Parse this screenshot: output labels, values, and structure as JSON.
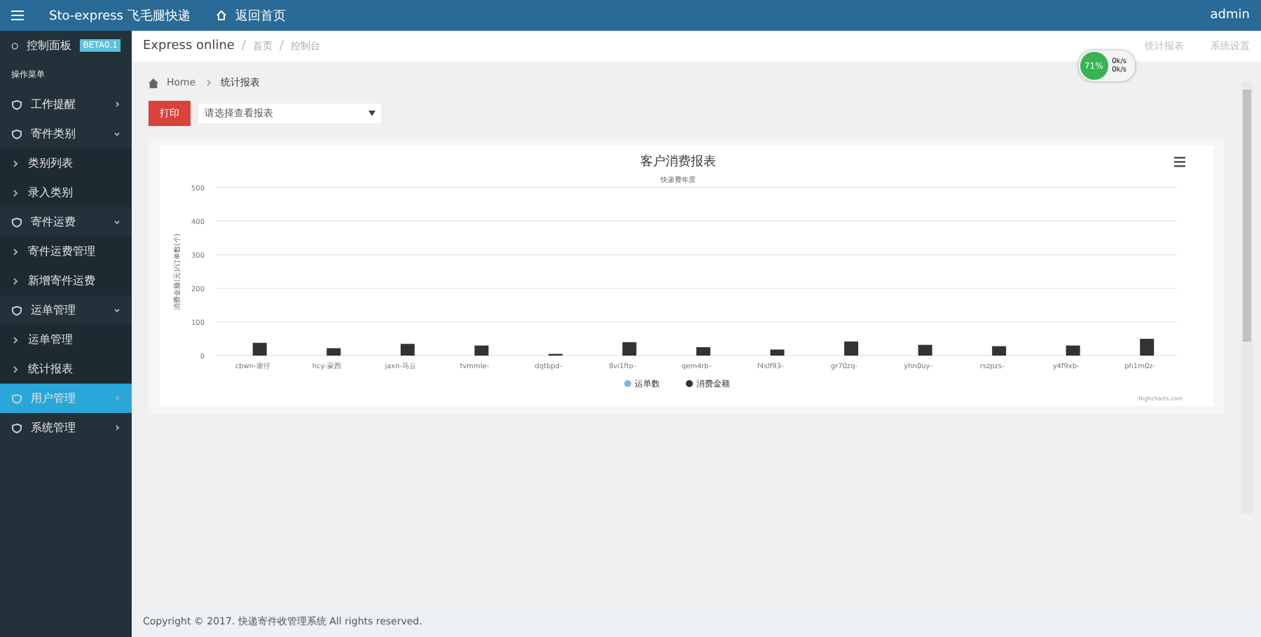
{
  "topbar": {
    "brand": "Sto-express 飞毛腿快递",
    "home_link": "返回首页",
    "user": "admin"
  },
  "sidebar": {
    "dashboard": {
      "label": "控制面板",
      "badge": "BETA0.1"
    },
    "section": "操作菜单",
    "items": [
      {
        "label": "工作提醒",
        "kind": "group",
        "expanded": false,
        "selected": false
      },
      {
        "label": "寄件类别",
        "kind": "group",
        "expanded": true,
        "selected": false
      },
      {
        "label": "类别列表",
        "kind": "sub",
        "selected": false
      },
      {
        "label": "录入类别",
        "kind": "sub",
        "selected": false
      },
      {
        "label": "寄件运费",
        "kind": "group",
        "expanded": true,
        "selected": false
      },
      {
        "label": "寄件运费管理",
        "kind": "sub",
        "selected": false
      },
      {
        "label": "新增寄件运费",
        "kind": "sub",
        "selected": false
      },
      {
        "label": "运单管理",
        "kind": "group",
        "expanded": true,
        "selected": false
      },
      {
        "label": "运单管理",
        "kind": "sub",
        "selected": false
      },
      {
        "label": "统计报表",
        "kind": "sub",
        "selected": false
      },
      {
        "label": "用户管理",
        "kind": "group",
        "expanded": false,
        "selected": true
      },
      {
        "label": "系统管理",
        "kind": "group",
        "expanded": false,
        "selected": false
      }
    ]
  },
  "header": {
    "breadcrumb": [
      "Express online",
      "首页",
      "控制台"
    ],
    "separator": "/",
    "actions": [
      "统计报表",
      "系统设置"
    ]
  },
  "speed_widget": {
    "percent": "71%",
    "up": "0k/s",
    "down": "0k/s"
  },
  "page": {
    "breadcrumb": [
      "Home",
      "统计报表"
    ],
    "print_button": "打印",
    "report_select": {
      "value": "请选择查看报表"
    }
  },
  "chart": {
    "credit": "Highcharts.com",
    "chart_data": {
      "type": "bar",
      "grid": true,
      "title": "客户消费报表",
      "subtitle": "快递费年度",
      "ylabel": "消费金额(元)/订单数(个)",
      "ylim": [
        0,
        500
      ],
      "yticks": [
        0,
        100,
        200,
        300,
        400,
        500
      ],
      "categories": [
        "cbwn-谢仔",
        "hcy-蒙西",
        "jaxn-马云",
        "tvmmle-",
        "dqtbpd-",
        "8vi1fto-",
        "qem4rb-",
        "f4slf93-",
        "gr70zq-",
        "yhn0uy-",
        "rszpzs-",
        "y4f9xb-",
        "ph1m0z-"
      ],
      "series": [
        {
          "name": "运单数",
          "color": "#7cb5ec",
          "values": [
            0,
            0,
            0,
            0,
            0,
            0,
            0,
            0,
            0,
            0,
            0,
            0,
            0
          ]
        },
        {
          "name": "消费金额",
          "color": "#333333",
          "values": [
            38,
            22,
            35,
            30,
            5,
            40,
            25,
            18,
            42,
            32,
            28,
            30,
            50
          ]
        }
      ]
    }
  },
  "footer": "Copyright © 2017. 快递寄件收管理系统 All rights reserved."
}
